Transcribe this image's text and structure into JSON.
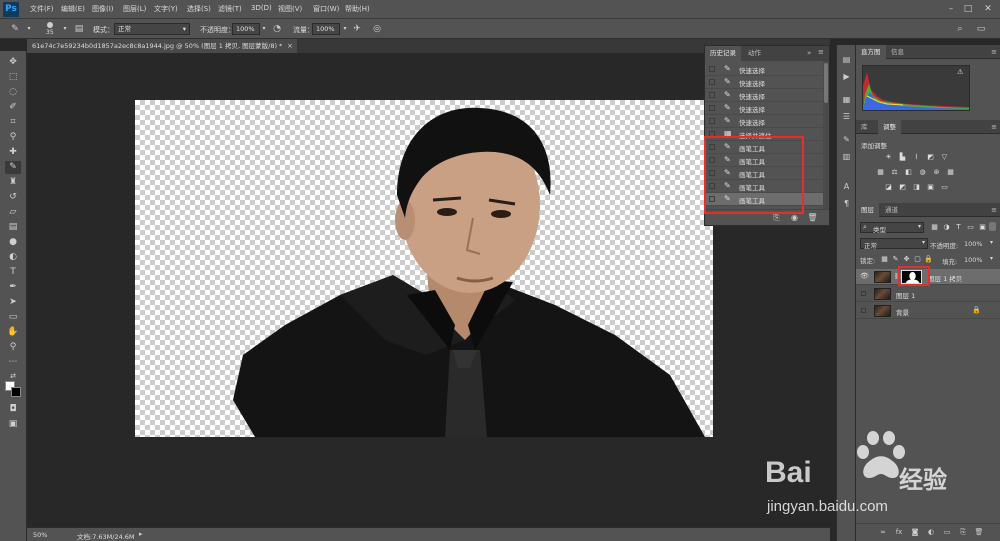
{
  "app": {
    "logo": "Ps"
  },
  "menubar": {
    "items": [
      "文件(F)",
      "编辑(E)",
      "图像(I)",
      "图层(L)",
      "文字(Y)",
      "选择(S)",
      "滤镜(T)",
      "3D(D)",
      "视图(V)",
      "窗口(W)",
      "帮助(H)"
    ]
  },
  "options": {
    "brush_size": "35",
    "mode_label": "模式：",
    "mode_value": "正常",
    "opacity_label": "不透明度：",
    "opacity_value": "100%",
    "flow_label": "流量：",
    "flow_value": "100%"
  },
  "document": {
    "tab_title": "61e74c7e59234b0d1857a2ec8c8a1944.jpg @ 50% (图层 1 拷贝, 图层蒙版/8) *",
    "close": "×"
  },
  "status": {
    "zoom": "50%",
    "doc_info": "文档:7.63M/24.6M"
  },
  "history": {
    "tabs": [
      "历史记录",
      "动作"
    ],
    "items": [
      {
        "label": "快速选择",
        "icon": "brush-icon",
        "selected": false
      },
      {
        "label": "快速选择",
        "icon": "brush-icon",
        "selected": false
      },
      {
        "label": "快速选择",
        "icon": "brush-icon",
        "selected": false
      },
      {
        "label": "快速选择",
        "icon": "brush-icon",
        "selected": false
      },
      {
        "label": "快速选择",
        "icon": "brush-icon",
        "selected": false
      },
      {
        "label": "选择并遮住",
        "icon": "mask-icon",
        "selected": false
      },
      {
        "label": "画笔工具",
        "icon": "brush-icon",
        "selected": false
      },
      {
        "label": "画笔工具",
        "icon": "brush-icon",
        "selected": false
      },
      {
        "label": "画笔工具",
        "icon": "brush-icon",
        "selected": false
      },
      {
        "label": "画笔工具",
        "icon": "brush-icon",
        "selected": false
      },
      {
        "label": "画笔工具",
        "icon": "brush-icon",
        "selected": true
      }
    ],
    "highlight_color": "#e0312f"
  },
  "panels": {
    "histogram_tabs": [
      "直方图",
      "信息"
    ],
    "lib_tabs": [
      "库",
      "调整"
    ],
    "add_adjustment": "添加调整",
    "layers_tabs": [
      "图层",
      "通道"
    ],
    "kind_filter": "类型",
    "blend_mode": "正常",
    "opacity_label": "不透明度:",
    "opacity_value": "100%",
    "lock_label": "锁定:",
    "fill_label": "填充:",
    "fill_value": "100%"
  },
  "layers": [
    {
      "name": "图层 1 拷贝",
      "visible": true,
      "has_mask": true,
      "selected": true
    },
    {
      "name": "图层 1",
      "visible": false,
      "has_mask": false,
      "selected": false
    },
    {
      "name": "背景",
      "visible": false,
      "has_mask": false,
      "selected": false,
      "locked": true
    }
  ],
  "watermark": {
    "brand": "Bai",
    "brand_cn": "经验",
    "url": "jingyan.baidu.com"
  }
}
